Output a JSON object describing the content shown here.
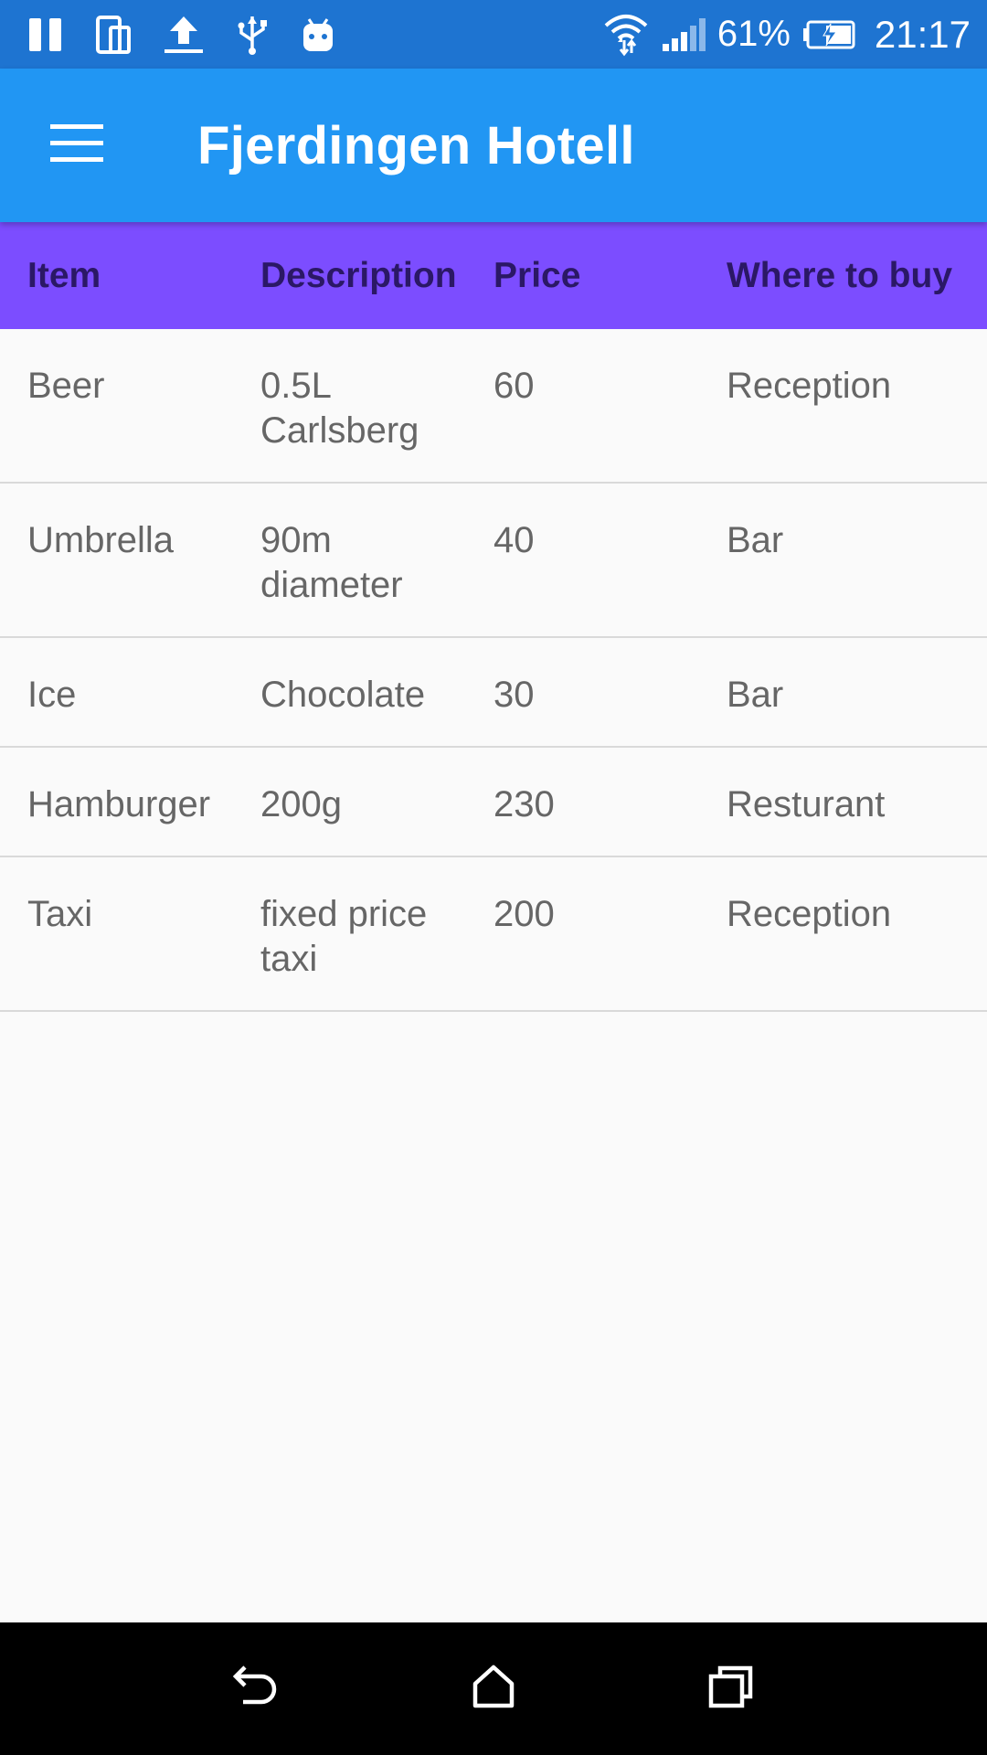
{
  "status_bar": {
    "battery_percent": "61%",
    "time": "21:17",
    "left_icons": [
      "pause-icon",
      "device-rotate-icon",
      "upload-icon",
      "usb-icon",
      "android-icon"
    ],
    "right_icons": [
      "wifi-icon",
      "signal-icon",
      "battery-charging-icon"
    ]
  },
  "app_bar": {
    "title": "Fjerdingen Hotell",
    "menu_icon": "hamburger-menu-icon",
    "color": "#2196f3"
  },
  "table": {
    "header_color": "#7c4dff",
    "columns": [
      "Item",
      "Description",
      "Price",
      "Where to buy"
    ],
    "rows": [
      {
        "item": "Beer",
        "description": "0.5L\nCarlsberg",
        "price": "60",
        "where": "Reception"
      },
      {
        "item": "Umbrella",
        "description": "90m\ndiameter",
        "price": "40",
        "where": "Bar"
      },
      {
        "item": "Ice",
        "description": "Chocolate",
        "price": "30",
        "where": "Bar"
      },
      {
        "item": "Hamburger",
        "description": "200g",
        "price": "230",
        "where": "Resturant"
      },
      {
        "item": "Taxi",
        "description": "fixed price\ntaxi",
        "price": "200",
        "where": "Reception"
      }
    ]
  },
  "nav_bar": {
    "icons": [
      "back-icon",
      "home-icon",
      "recents-icon"
    ]
  }
}
